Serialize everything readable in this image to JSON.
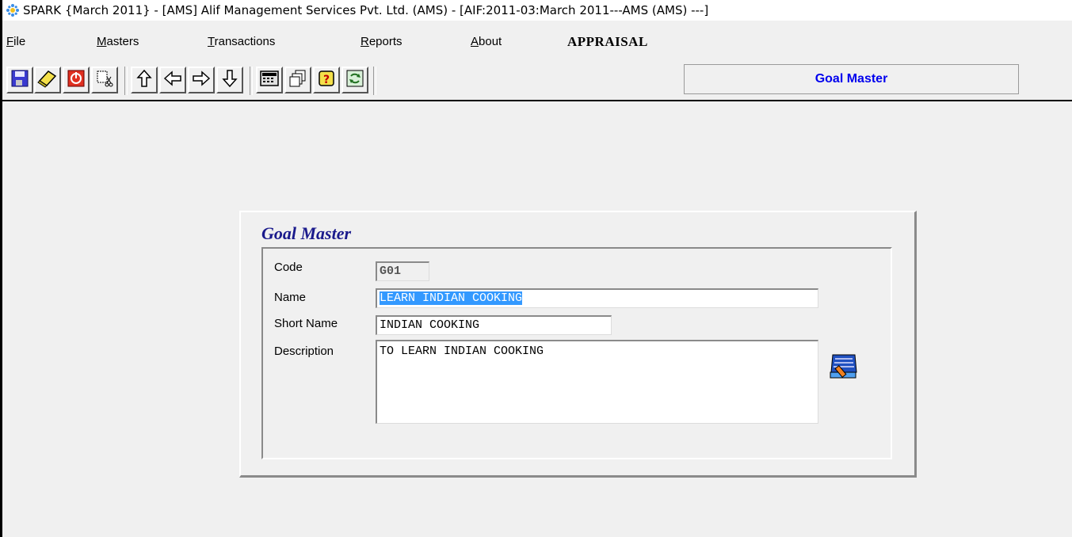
{
  "window": {
    "title": "SPARK {March 2011} - [AMS] Alif Management Services Pvt. Ltd. (AMS)  - [AIF:2011-03:March 2011---AMS (AMS) ---]"
  },
  "menu": {
    "file": {
      "label": "File",
      "key": "F",
      "rest": "ile"
    },
    "masters": {
      "label": "Masters",
      "key": "M",
      "rest": "asters"
    },
    "transactions": {
      "label": "Transactions",
      "key": "T",
      "rest": "ransactions"
    },
    "reports": {
      "label": "Reports",
      "key": "R",
      "rest": "eports"
    },
    "about": {
      "label": "About",
      "key": "A",
      "rest": "bout"
    },
    "module": "APPRAISAL"
  },
  "toolbar": {
    "icons": [
      "save-icon",
      "edit-icon",
      "exit-icon",
      "cut-icon",
      "arrow-up-icon",
      "arrow-left-icon",
      "arrow-right-icon",
      "arrow-down-icon",
      "calculator-icon",
      "copy-icon",
      "help-icon",
      "refresh-icon"
    ],
    "screen_caption": "Goal Master"
  },
  "form": {
    "title": "Goal Master",
    "code_label": "Code",
    "code_value": "G01",
    "name_label": "Name",
    "name_value": "LEARN INDIAN COOKING",
    "short_name_label": "Short Name",
    "short_name_value": "INDIAN COOKING",
    "description_label": "Description",
    "description_value": "TO LEARN INDIAN COOKING"
  },
  "colors": {
    "caption_text": "#0000ee",
    "form_title": "#1a1a8c",
    "selection": "#3399ff"
  }
}
